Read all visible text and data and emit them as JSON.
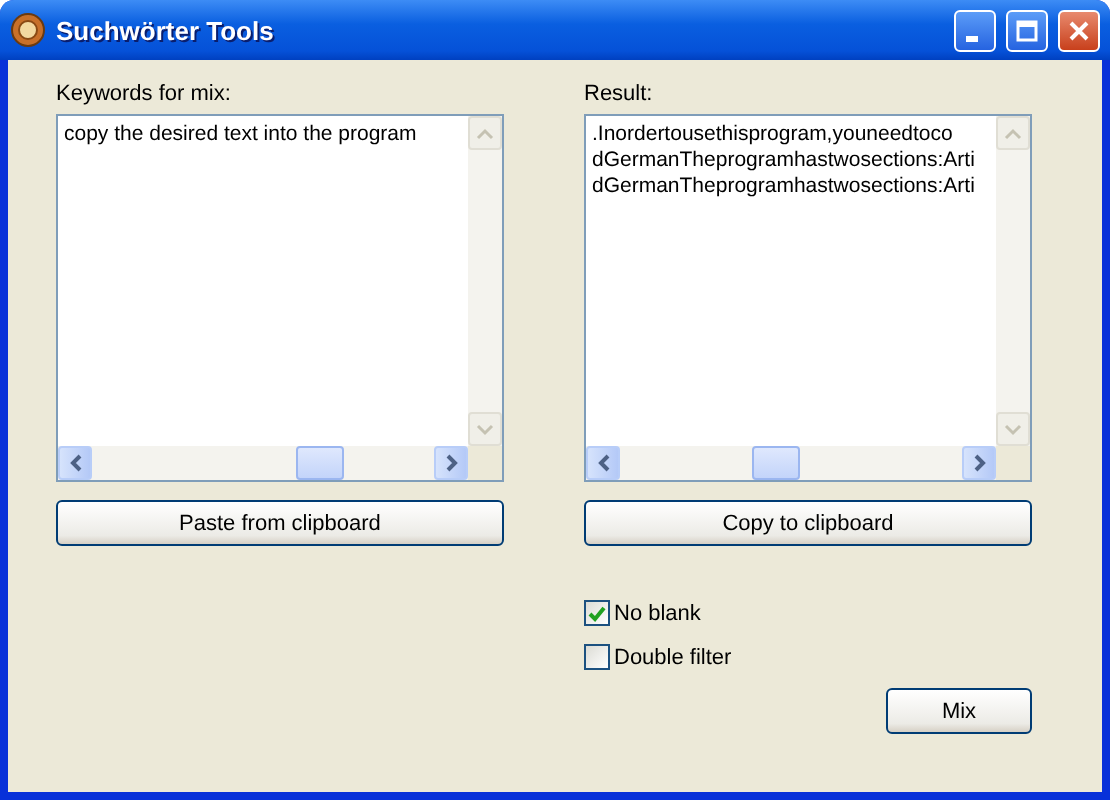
{
  "window": {
    "title": "Suchwörter Tools"
  },
  "input": {
    "label": "Keywords for mix:",
    "lines": [
      "copy the desired text into the program"
    ]
  },
  "paste_button": "Paste from clipboard",
  "result": {
    "label": "Result:",
    "lines": [
      ".Inordertousethisprogram,youneedtoco",
      "dGermanTheprogramhastwosections:Arti",
      "dGermanTheprogramhastwosections:Arti"
    ]
  },
  "copy_button": "Copy to clipboard",
  "options": [
    {
      "label": "No blank",
      "checked": true
    },
    {
      "label": "Double filter",
      "checked": false
    }
  ],
  "mix_button": "Mix"
}
